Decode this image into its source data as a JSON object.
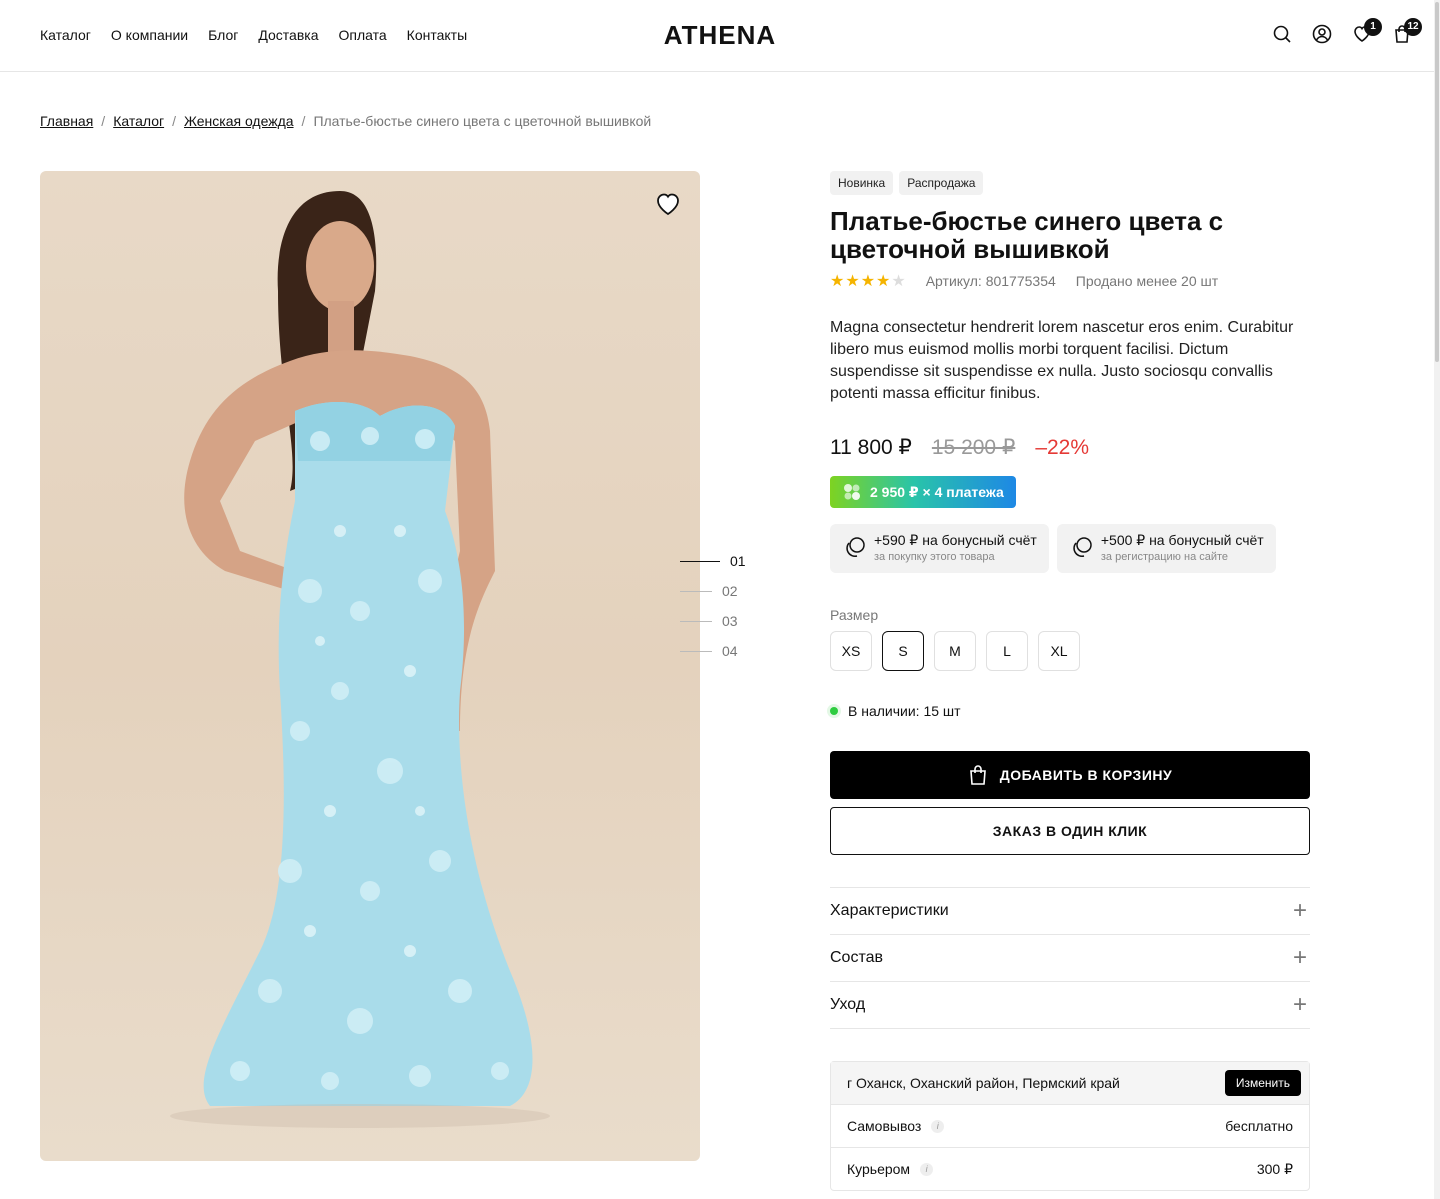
{
  "header": {
    "logo": "ATHENA",
    "nav": [
      "Каталог",
      "О компании",
      "Блог",
      "Доставка",
      "Оплата",
      "Контакты"
    ],
    "favorites_count": "1",
    "cart_count": "12"
  },
  "breadcrumbs": {
    "items": [
      "Главная",
      "Каталог",
      "Женская одежда"
    ],
    "separator": "/",
    "current": "Платье-бюстье синего цвета с цветочной вышивкой"
  },
  "gallery": {
    "pages": [
      "01",
      "02",
      "03",
      "04"
    ],
    "active_page": "01"
  },
  "product": {
    "tags": [
      "Новинка",
      "Распродажа"
    ],
    "title": "Платье-бюстье синего цвета с цветочной вышивкой",
    "rating": 4,
    "rating_max": 5,
    "sku": "Артикул: 801775354",
    "sold": "Продано менее 20 шт",
    "description": "Magna consectetur hendrerit lorem nascetur eros enim. Curabitur libero mus euismod mollis morbi torquent facilisi. Dictum suspendisse sit suspendisse ex nulla. Justo sociosqu convallis potenti massa efficitur finibus.",
    "price": "11 800 ₽",
    "old_price": "15 200 ₽",
    "discount": "–22%",
    "split_payment": "2 950 ₽ × 4 платежа",
    "bonuses": [
      {
        "title": "+590 ₽ на бонусный счёт",
        "subtitle": "за покупку этого товара"
      },
      {
        "title": "+500 ₽ на бонусный счёт",
        "subtitle": "за регистрацию на сайте"
      }
    ],
    "size_label": "Размер",
    "sizes": [
      "XS",
      "S",
      "M",
      "L",
      "XL"
    ],
    "selected_size": "S",
    "stock": "В наличии: 15 шт",
    "add_to_cart": "ДОБАВИТЬ В КОРЗИНУ",
    "one_click": "ЗАКАЗ В ОДИН КЛИК",
    "accordion": [
      "Характеристики",
      "Состав",
      "Уход"
    ]
  },
  "delivery": {
    "location": "г Оханск, Оханский район, Пермский край",
    "change_label": "Изменить",
    "options": [
      {
        "name": "Самовывоз",
        "price": "бесплатно"
      },
      {
        "name": "Курьером",
        "price": "300 ₽"
      }
    ]
  },
  "colors": {
    "accent": "#000000",
    "discount": "#e53935",
    "stars": "#f5b400",
    "in_stock": "#2ecc40"
  }
}
